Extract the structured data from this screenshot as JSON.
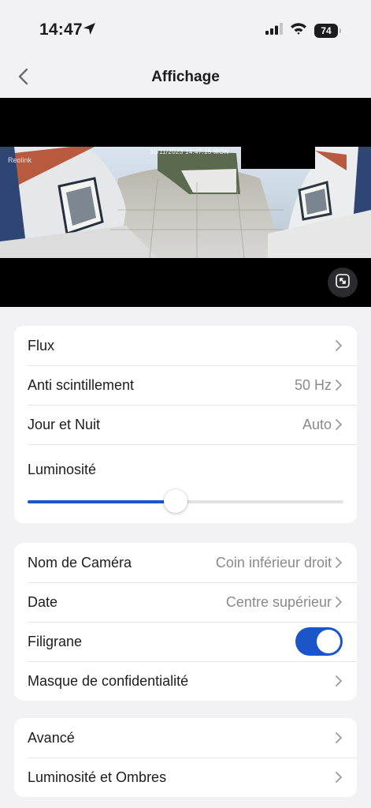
{
  "status_bar": {
    "time": "14:47",
    "battery": "74"
  },
  "nav": {
    "title": "Affichage"
  },
  "camera": {
    "brand": "Reolink",
    "date_overlay": "30/11/2023 14:47:15 MON"
  },
  "group1": {
    "flux": {
      "label": "Flux"
    },
    "anti_flicker": {
      "label": "Anti scintillement",
      "value": "50 Hz"
    },
    "day_night": {
      "label": "Jour et Nuit",
      "value": "Auto"
    },
    "brightness": {
      "label": "Luminosité",
      "level_fraction": 0.47
    }
  },
  "group2": {
    "camera_name": {
      "label": "Nom de Caméra",
      "value": "Coin inférieur droit"
    },
    "date": {
      "label": "Date",
      "value": "Centre supérieur"
    },
    "watermark": {
      "label": "Filigrane",
      "on": true
    },
    "privacy_mask": {
      "label": "Masque de confidentialité"
    }
  },
  "group3": {
    "advanced": {
      "label": "Avancé"
    },
    "light_shadows": {
      "label": "Luminosité et Ombres"
    }
  },
  "colors": {
    "accent": "#1a55c9",
    "background": "#f2f2f4",
    "secondary_text": "#8a8a8e"
  },
  "icons": [
    "location-arrow-icon",
    "signal-icon",
    "wifi-icon",
    "battery-icon",
    "back-chevron-icon",
    "expand-icon",
    "chevron-right-icon"
  ]
}
